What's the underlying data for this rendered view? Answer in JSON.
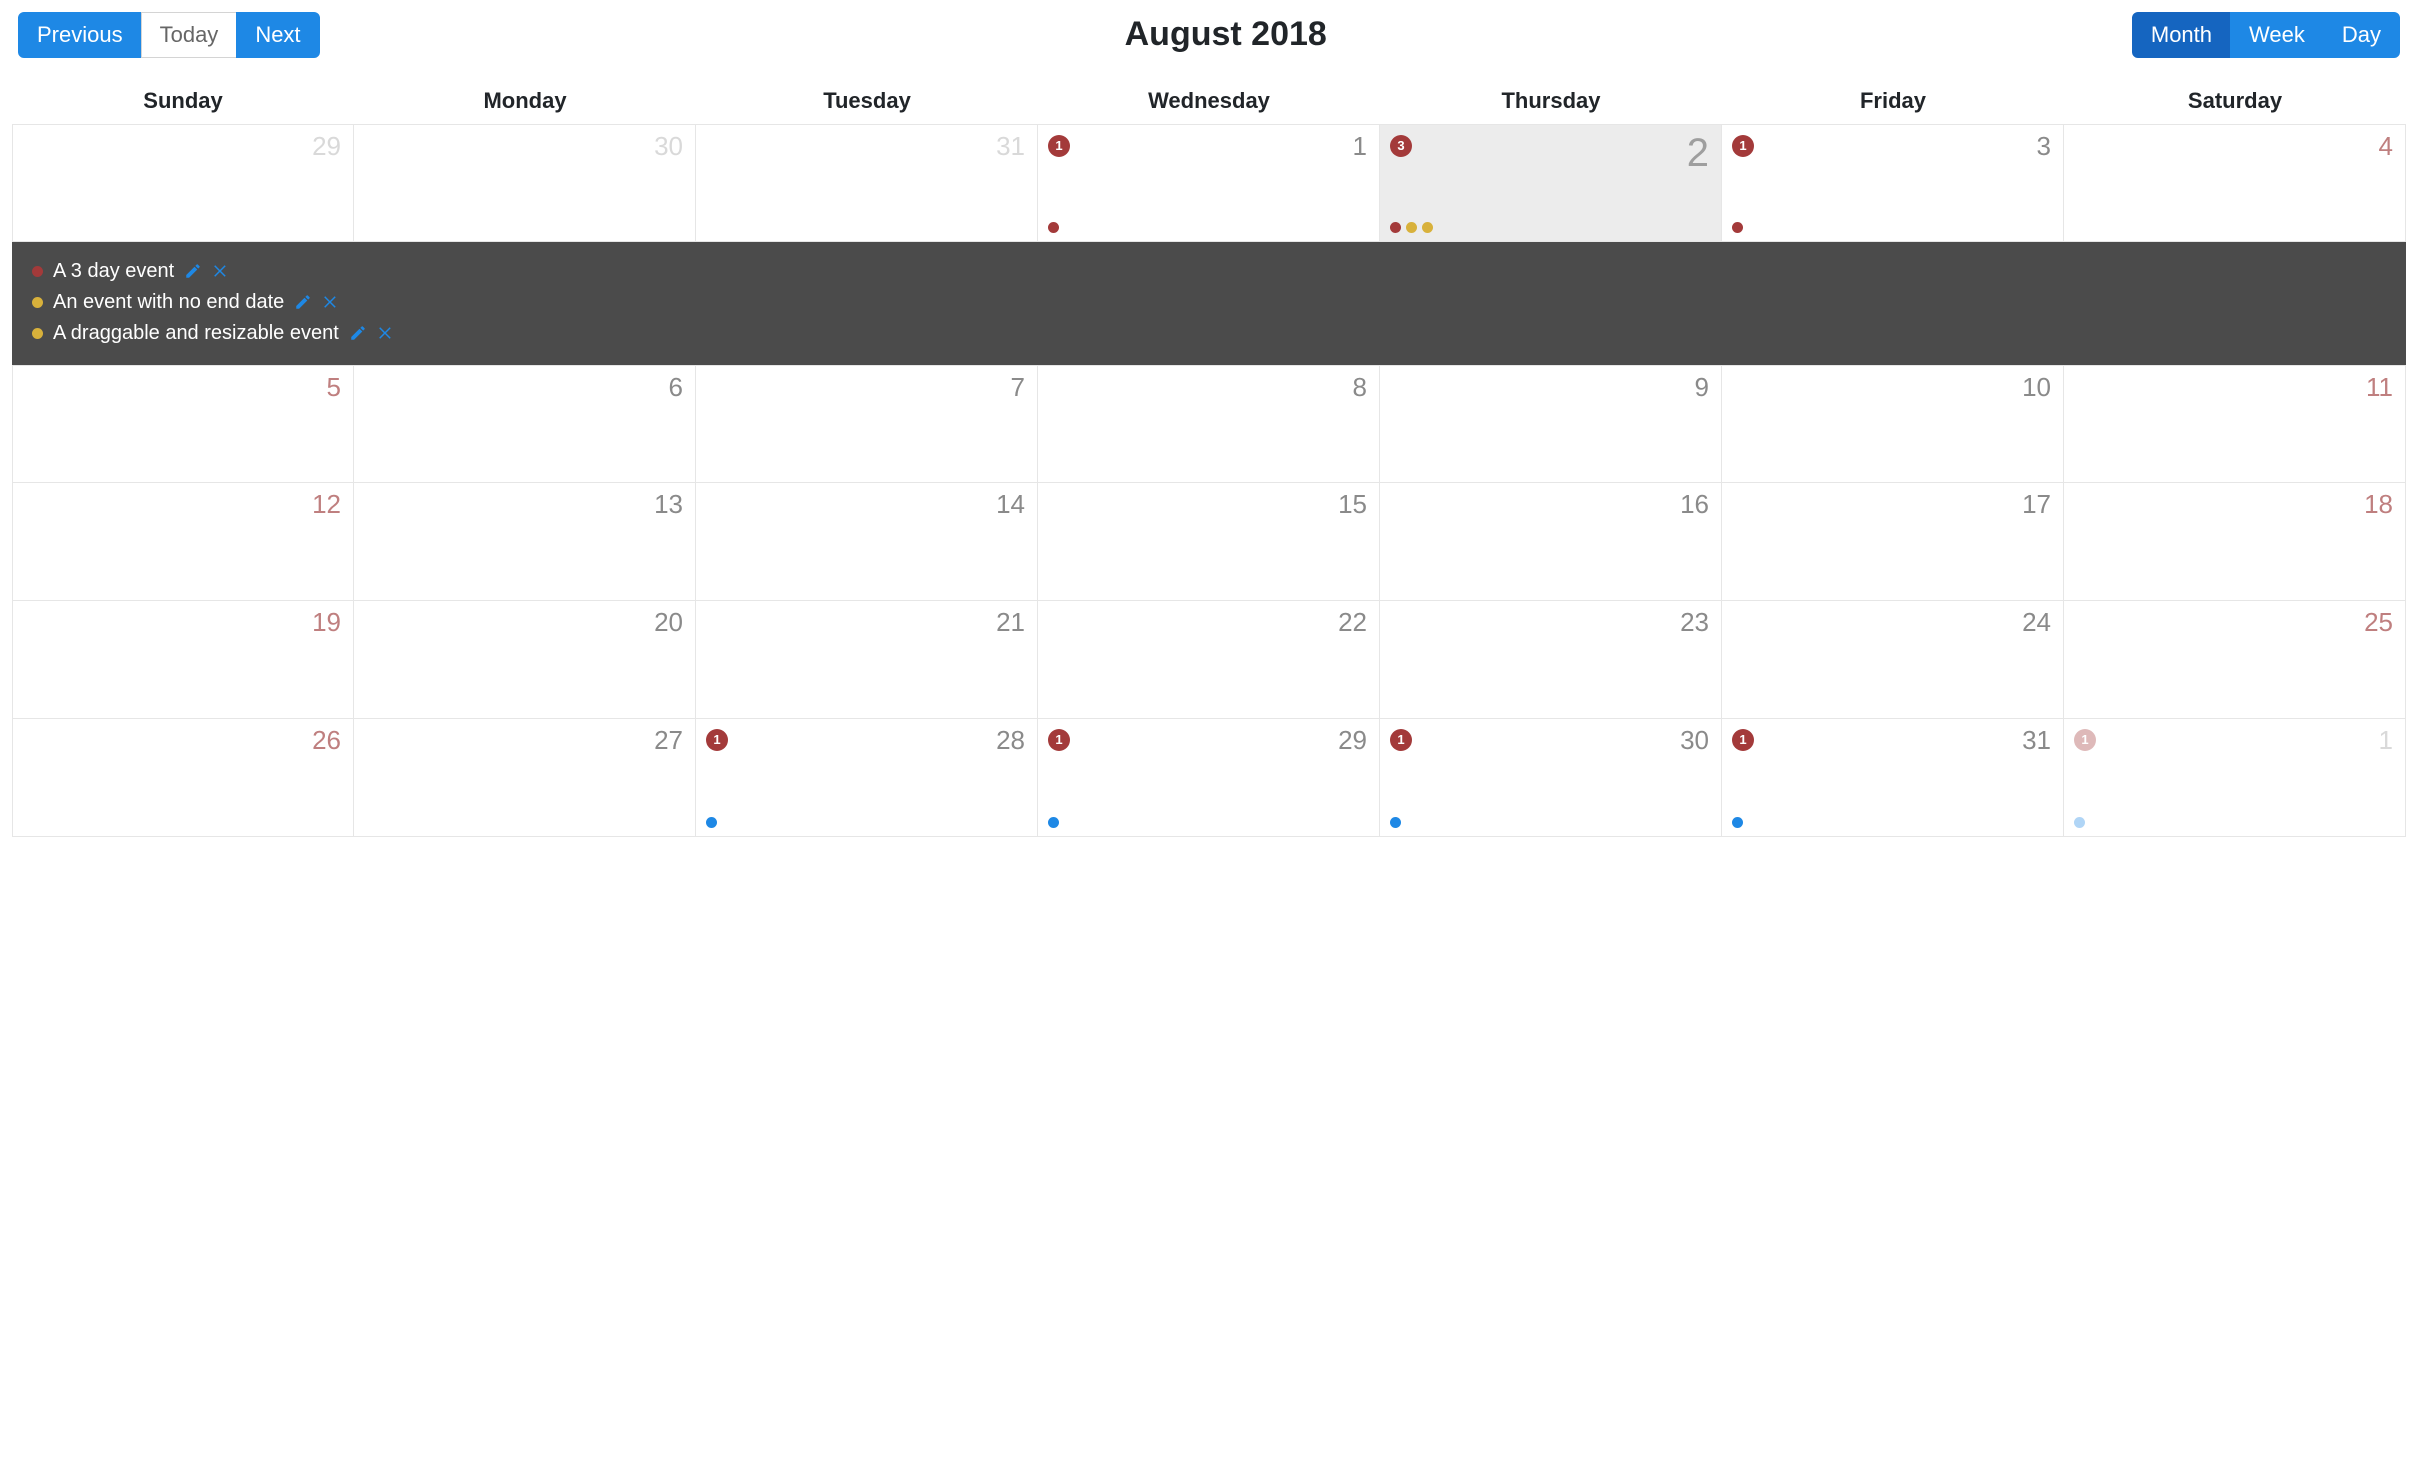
{
  "toolbar": {
    "previous": "Previous",
    "today": "Today",
    "next": "Next",
    "month": "Month",
    "week": "Week",
    "day": "Day"
  },
  "title": "August 2018",
  "dow": [
    "Sunday",
    "Monday",
    "Tuesday",
    "Wednesday",
    "Thursday",
    "Friday",
    "Saturday"
  ],
  "colors": {
    "red": "#a33a3a",
    "yellow": "#d8b13b",
    "blue": "#1e88e5"
  },
  "expanded_day_index": 4,
  "expanded_events": [
    {
      "color": "red",
      "title": "A 3 day event"
    },
    {
      "color": "yellow",
      "title": "An event with no end date"
    },
    {
      "color": "yellow",
      "title": "A draggable and resizable event"
    }
  ],
  "weeks": [
    [
      {
        "num": "29",
        "out": true,
        "weekend": true,
        "today": false,
        "badge": null,
        "dots": []
      },
      {
        "num": "30",
        "out": true,
        "weekend": false,
        "today": false,
        "badge": null,
        "dots": []
      },
      {
        "num": "31",
        "out": true,
        "weekend": false,
        "today": false,
        "badge": null,
        "dots": []
      },
      {
        "num": "1",
        "out": false,
        "weekend": false,
        "today": false,
        "badge": "1",
        "dots": [
          "red"
        ]
      },
      {
        "num": "2",
        "out": false,
        "weekend": false,
        "today": true,
        "badge": "3",
        "dots": [
          "red",
          "yellow",
          "yellow"
        ]
      },
      {
        "num": "3",
        "out": false,
        "weekend": false,
        "today": false,
        "badge": "1",
        "dots": [
          "red"
        ]
      },
      {
        "num": "4",
        "out": false,
        "weekend": true,
        "today": false,
        "badge": null,
        "dots": []
      }
    ],
    [
      {
        "num": "5",
        "out": false,
        "weekend": true,
        "today": false,
        "badge": null,
        "dots": []
      },
      {
        "num": "6",
        "out": false,
        "weekend": false,
        "today": false,
        "badge": null,
        "dots": []
      },
      {
        "num": "7",
        "out": false,
        "weekend": false,
        "today": false,
        "badge": null,
        "dots": []
      },
      {
        "num": "8",
        "out": false,
        "weekend": false,
        "today": false,
        "badge": null,
        "dots": []
      },
      {
        "num": "9",
        "out": false,
        "weekend": false,
        "today": false,
        "badge": null,
        "dots": []
      },
      {
        "num": "10",
        "out": false,
        "weekend": false,
        "today": false,
        "badge": null,
        "dots": []
      },
      {
        "num": "11",
        "out": false,
        "weekend": true,
        "today": false,
        "badge": null,
        "dots": []
      }
    ],
    [
      {
        "num": "12",
        "out": false,
        "weekend": true,
        "today": false,
        "badge": null,
        "dots": []
      },
      {
        "num": "13",
        "out": false,
        "weekend": false,
        "today": false,
        "badge": null,
        "dots": []
      },
      {
        "num": "14",
        "out": false,
        "weekend": false,
        "today": false,
        "badge": null,
        "dots": []
      },
      {
        "num": "15",
        "out": false,
        "weekend": false,
        "today": false,
        "badge": null,
        "dots": []
      },
      {
        "num": "16",
        "out": false,
        "weekend": false,
        "today": false,
        "badge": null,
        "dots": []
      },
      {
        "num": "17",
        "out": false,
        "weekend": false,
        "today": false,
        "badge": null,
        "dots": []
      },
      {
        "num": "18",
        "out": false,
        "weekend": true,
        "today": false,
        "badge": null,
        "dots": []
      }
    ],
    [
      {
        "num": "19",
        "out": false,
        "weekend": true,
        "today": false,
        "badge": null,
        "dots": []
      },
      {
        "num": "20",
        "out": false,
        "weekend": false,
        "today": false,
        "badge": null,
        "dots": []
      },
      {
        "num": "21",
        "out": false,
        "weekend": false,
        "today": false,
        "badge": null,
        "dots": []
      },
      {
        "num": "22",
        "out": false,
        "weekend": false,
        "today": false,
        "badge": null,
        "dots": []
      },
      {
        "num": "23",
        "out": false,
        "weekend": false,
        "today": false,
        "badge": null,
        "dots": []
      },
      {
        "num": "24",
        "out": false,
        "weekend": false,
        "today": false,
        "badge": null,
        "dots": []
      },
      {
        "num": "25",
        "out": false,
        "weekend": true,
        "today": false,
        "badge": null,
        "dots": []
      }
    ],
    [
      {
        "num": "26",
        "out": false,
        "weekend": true,
        "today": false,
        "badge": null,
        "dots": []
      },
      {
        "num": "27",
        "out": false,
        "weekend": false,
        "today": false,
        "badge": null,
        "dots": []
      },
      {
        "num": "28",
        "out": false,
        "weekend": false,
        "today": false,
        "badge": "1",
        "dots": [
          "blue"
        ]
      },
      {
        "num": "29",
        "out": false,
        "weekend": false,
        "today": false,
        "badge": "1",
        "dots": [
          "blue"
        ]
      },
      {
        "num": "30",
        "out": false,
        "weekend": false,
        "today": false,
        "badge": "1",
        "dots": [
          "blue"
        ]
      },
      {
        "num": "31",
        "out": false,
        "weekend": false,
        "today": false,
        "badge": "1",
        "dots": [
          "blue"
        ]
      },
      {
        "num": "1",
        "out": true,
        "weekend": true,
        "today": false,
        "badge": "1",
        "badge_faded": true,
        "dots": [
          "blue"
        ],
        "dots_faded": true
      }
    ]
  ]
}
